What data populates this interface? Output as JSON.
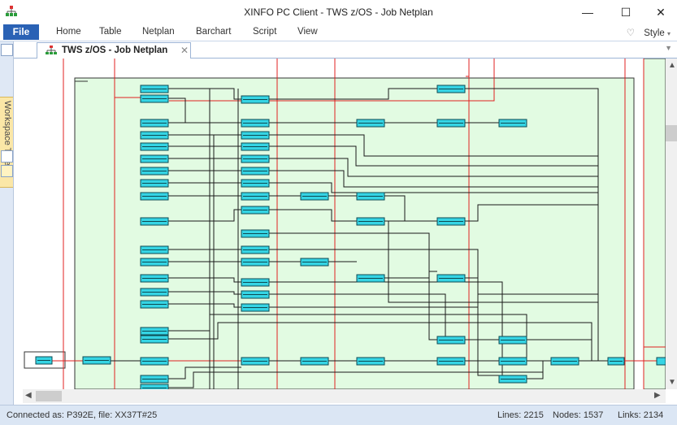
{
  "window": {
    "title": "XINFO PC Client - TWS z/OS - Job Netplan",
    "minimize": "—",
    "maximize": "☐",
    "close": "✕"
  },
  "menubar": {
    "file": "File",
    "items": [
      "Home",
      "Table",
      "Netplan",
      "Barchart",
      "Script",
      "View"
    ],
    "style": "Style"
  },
  "sidebar": {
    "workspace_tree": "Workspace Tree"
  },
  "tab": {
    "label": "TWS z/OS - Job Netplan",
    "close": "✕"
  },
  "status": {
    "connected": "Connected as: P392E, file: XX37T#25",
    "lines": "Lines: 2215",
    "nodes": "Nodes: 1537",
    "links": "Links: 2134"
  },
  "colors": {
    "node_fill": "#35d4e4",
    "group_fill": "#e2fbe2",
    "red_line": "#e02020",
    "accent": "#2a62b5"
  },
  "icons": {
    "app": "netplan-app-icon",
    "scroll_up": "chevron-up-icon",
    "scroll_down": "chevron-down-icon",
    "scroll_left": "chevron-left-icon",
    "scroll_right": "chevron-right-icon"
  }
}
